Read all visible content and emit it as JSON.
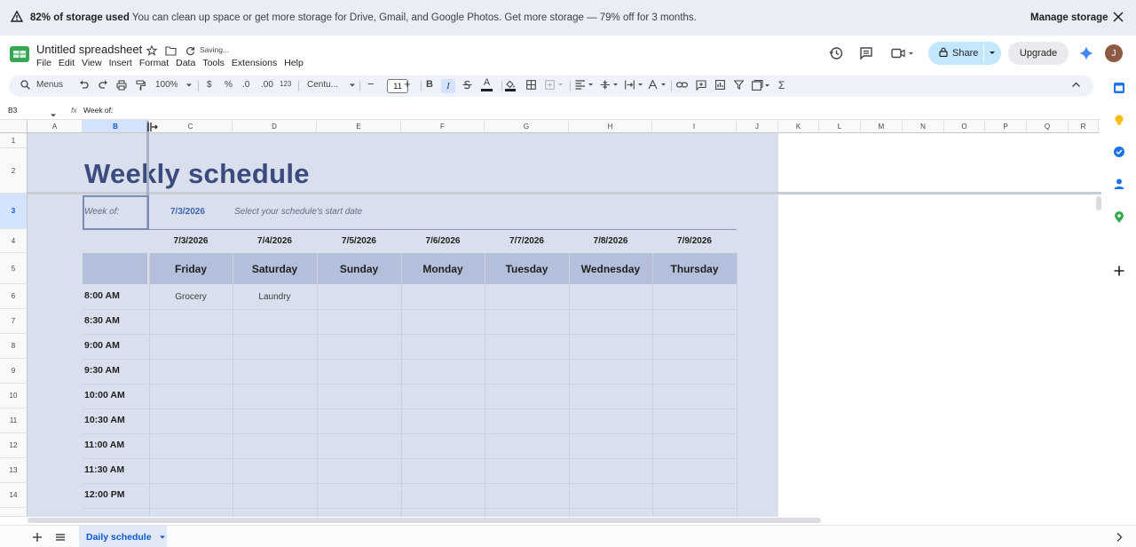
{
  "banner": {
    "bold_text": "82% of storage used",
    "text": " You can clean up space or get more storage for Drive, Gmail, and Google Photos. Get more storage — 79% off for 3 months.",
    "manage": "Manage storage"
  },
  "doc": {
    "title": "Untitled spreadsheet",
    "status": "Saving..."
  },
  "menu": [
    "File",
    "Edit",
    "View",
    "Insert",
    "Format",
    "Data",
    "Tools",
    "Extensions",
    "Help"
  ],
  "header": {
    "share": "Share",
    "upgrade": "Upgrade",
    "avatar": "J"
  },
  "toolbar": {
    "menus": "Menus",
    "zoom": "100%",
    "currency": "$",
    "percent": "%",
    "dec_decrease": ".0",
    "dec_increase": ".00",
    "number_format": "123",
    "font": "Centu...",
    "font_size": "11",
    "bold": "B",
    "italic": "I",
    "text_color": "A",
    "minus": "−",
    "plus": "+",
    "sigma": "Σ"
  },
  "formula": {
    "cell": "B3",
    "fx": "fx",
    "value": "Week of:"
  },
  "columns": [
    "A",
    "B",
    "C",
    "D",
    "E",
    "F",
    "G",
    "H",
    "I",
    "J",
    "K",
    "L",
    "M",
    "N",
    "O",
    "P",
    "Q",
    "R"
  ],
  "rows": [
    "1",
    "2",
    "3",
    "4",
    "5",
    "6",
    "7",
    "8",
    "9",
    "10",
    "11",
    "12",
    "13",
    "14"
  ],
  "schedule": {
    "title": "Weekly schedule",
    "week_of": "Week of:",
    "start_date": "7/3/2026",
    "hint": "Select your schedule's start date",
    "dates": [
      "7/3/2026",
      "7/4/2026",
      "7/5/2026",
      "7/6/2026",
      "7/7/2026",
      "7/8/2026",
      "7/9/2026"
    ],
    "days": [
      "Friday",
      "Saturday",
      "Sunday",
      "Monday",
      "Tuesday",
      "Wednesday",
      "Thursday"
    ],
    "times": [
      "8:00 AM",
      "8:30 AM",
      "9:00 AM",
      "9:30 AM",
      "10:00 AM",
      "10:30 AM",
      "11:00 AM",
      "11:30 AM",
      "12:00 PM"
    ],
    "entries": {
      "friday_800": "Grocery",
      "saturday_800": "Laundry"
    }
  },
  "sheet_tab": "Daily schedule",
  "colors": {
    "accent": "#0b57d0",
    "sheet_bg": "#d9dfec",
    "day_header": "#b4bfdc",
    "title": "#3c4a7d"
  }
}
